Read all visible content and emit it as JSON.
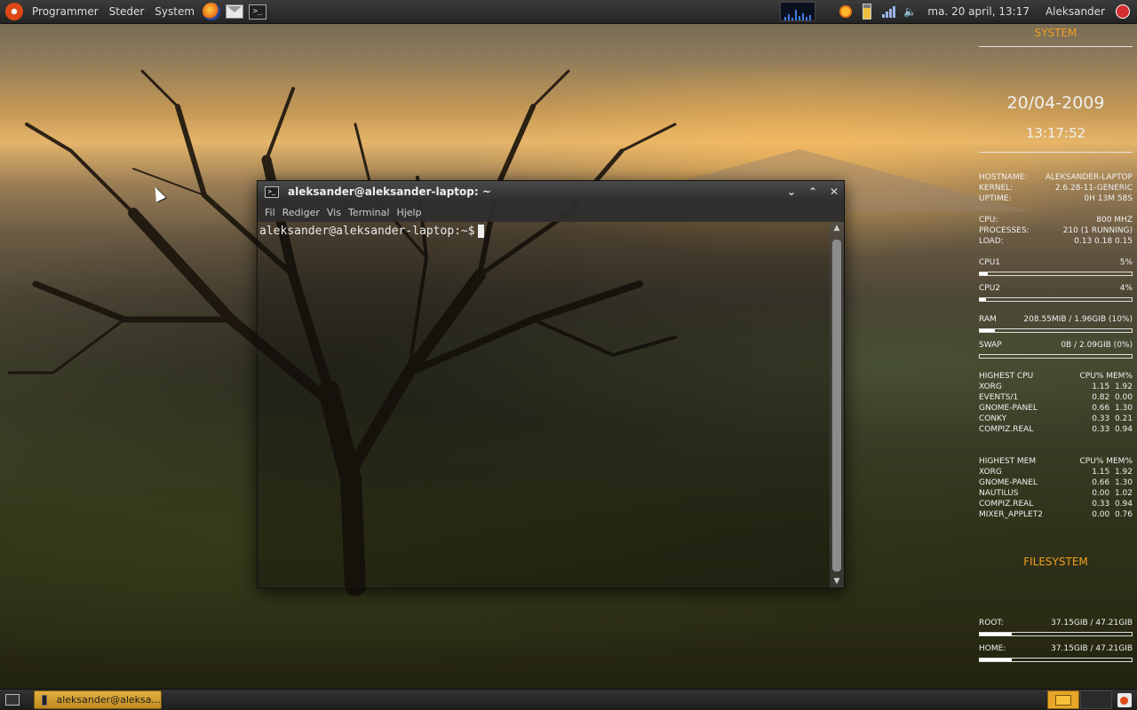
{
  "top_panel": {
    "menus": [
      "Programmer",
      "Steder",
      "System"
    ],
    "launchers": [
      "firefox-icon",
      "mail-icon",
      "terminal-icon"
    ],
    "clock": "ma. 20 april, 13:17",
    "user": "Aleksander"
  },
  "terminal": {
    "title": "aleksander@aleksander-laptop: ~",
    "menu": [
      "Fil",
      "Rediger",
      "Vis",
      "Terminal",
      "Hjelp"
    ],
    "prompt": "aleksander@aleksander-laptop:~$"
  },
  "conky": {
    "system_heading": "SYSTEM",
    "date": "20/04-2009",
    "time": "13:17:52",
    "info": [
      {
        "label": "HOSTNAME:",
        "value": "ALEKSANDER-LAPTOP"
      },
      {
        "label": "KERNEL:",
        "value": "2.6.28-11-GENERIC"
      },
      {
        "label": "UPTIME:",
        "value": "0H 13M 58S"
      }
    ],
    "info2": [
      {
        "label": "CPU:",
        "value": "800 MHZ"
      },
      {
        "label": "PROCESSES:",
        "value": "210 (1 RUNNING)"
      },
      {
        "label": "LOAD:",
        "value": "0.13 0.18 0.15"
      }
    ],
    "cpu1": {
      "label": "CPU1",
      "value": "5%",
      "fraction": 0.05
    },
    "cpu2": {
      "label": "CPU2",
      "value": "4%",
      "fraction": 0.04
    },
    "ram": {
      "label": "RAM",
      "value": "208.55MIB / 1.96GIB (10%)",
      "fraction": 0.1
    },
    "swap": {
      "label": "SWAP",
      "value": "0B / 2.09GIB (0%)",
      "fraction": 0.0
    },
    "highest_cpu": {
      "heading": "HIGHEST CPU",
      "cols": "CPU% MEM%",
      "rows": [
        {
          "name": "XORG",
          "vals": "1.15  1.92"
        },
        {
          "name": "EVENTS/1",
          "vals": "0.82  0.00"
        },
        {
          "name": "GNOME-PANEL",
          "vals": "0.66  1.30"
        },
        {
          "name": "CONKY",
          "vals": "0.33  0.21"
        },
        {
          "name": "COMPIZ.REAL",
          "vals": "0.33  0.94"
        }
      ]
    },
    "highest_mem": {
      "heading": "HIGHEST MEM",
      "cols": "CPU% MEM%",
      "rows": [
        {
          "name": "XORG",
          "vals": "1.15  1.92"
        },
        {
          "name": "GNOME-PANEL",
          "vals": "0.66  1.30"
        },
        {
          "name": "NAUTILUS",
          "vals": "0.00  1.02"
        },
        {
          "name": "COMPIZ.REAL",
          "vals": "0.33  0.94"
        },
        {
          "name": "MIXER_APPLET2",
          "vals": "0.00  0.76"
        }
      ]
    },
    "filesystem_heading": "FILESYSTEM",
    "root": {
      "label": "ROOT:",
      "value": "37.15GIB / 47.21GIB",
      "fraction": 0.21
    },
    "home": {
      "label": "HOME:",
      "value": "37.15GIB / 47.21GIB",
      "fraction": 0.21
    }
  },
  "bottom_panel": {
    "task": "aleksander@aleksa..."
  },
  "colors": {
    "accent": "#f0a020",
    "panel": "#2a2a2a",
    "task": "#e4b040"
  }
}
